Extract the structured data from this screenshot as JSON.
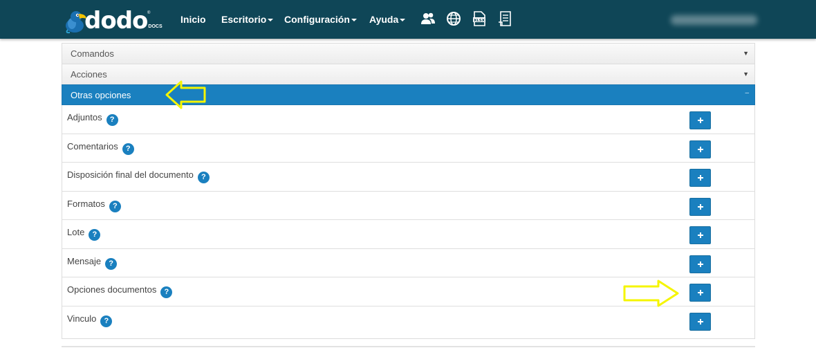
{
  "brand": {
    "name": "dodo",
    "sub": "DOCS",
    "reg": "®"
  },
  "nav": {
    "inicio": "Inicio",
    "escritorio": "Escritorio",
    "configuracion": "Configuración",
    "ayuda": "Ayuda"
  },
  "nav_icons": [
    "users-icon",
    "globe-icon",
    "xlsx-icon",
    "document-list-icon"
  ],
  "panels": {
    "comandos": "Comandos",
    "acciones": "Acciones",
    "otras": "Otras opciones",
    "collapsed_arrow": "▼",
    "expanded_arrow": "–"
  },
  "options": [
    {
      "label": "Adjuntos",
      "help": "?"
    },
    {
      "label": "Comentarios",
      "help": "?"
    },
    {
      "label": "Disposición final del documento",
      "help": "?"
    },
    {
      "label": "Formatos",
      "help": "?"
    },
    {
      "label": "Lote",
      "help": "?"
    },
    {
      "label": "Mensaje",
      "help": "?"
    },
    {
      "label": "Opciones documentos",
      "help": "?"
    },
    {
      "label": "Vinculo",
      "help": "?"
    }
  ],
  "colors": {
    "navbar": "#0f4657",
    "accent": "#1a80bf",
    "highlight_arrow": "#f5f500"
  }
}
